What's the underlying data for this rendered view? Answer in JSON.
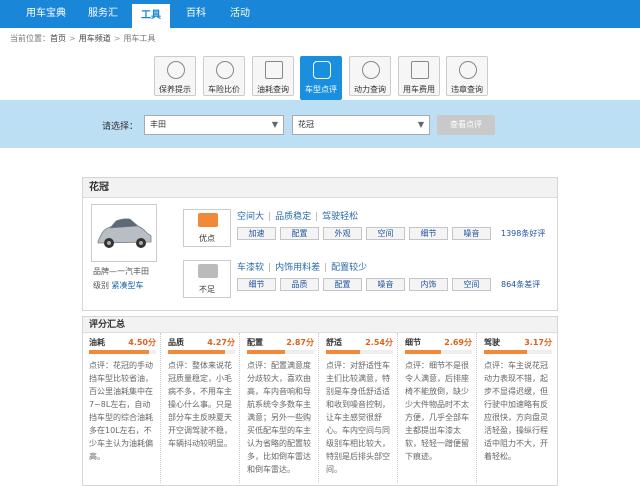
{
  "nav": [
    {
      "label": "用车宝典",
      "active": false
    },
    {
      "label": "服务汇",
      "active": false
    },
    {
      "label": "工具",
      "active": true
    },
    {
      "label": "百科",
      "active": false
    },
    {
      "label": "活动",
      "active": false
    }
  ],
  "breadcrumb": {
    "prefix": "当前位置：",
    "items": [
      "首页",
      "用车频道",
      "用车工具"
    ],
    "sep": ">"
  },
  "tools": [
    {
      "label": "保养提示",
      "icon": "wrench-icon"
    },
    {
      "label": "车险比价",
      "icon": "shield-icon"
    },
    {
      "label": "油耗查询",
      "icon": "fuel-icon"
    },
    {
      "label": "车型点评",
      "icon": "comment-icon",
      "active": true
    },
    {
      "label": "动力查询",
      "icon": "engine-icon"
    },
    {
      "label": "用车费用",
      "icon": "yuan-icon"
    },
    {
      "label": "违章查询",
      "icon": "search-icon"
    }
  ],
  "selection": {
    "label": "请选择：",
    "brand": "丰田",
    "model": "花冠",
    "button": "查看点评"
  },
  "model": {
    "title": "花冠",
    "brand_label": "品牌",
    "brand_value": "一汽丰田",
    "level_label": "级别",
    "level_value": "紧凑型车"
  },
  "pros": {
    "badge": "优点",
    "summary": [
      "空间大",
      "品质稳定",
      "驾驶轻松"
    ],
    "tags": [
      "加速",
      "配置",
      "外观",
      "空间",
      "细节",
      "噪音"
    ],
    "count": "1398条好评"
  },
  "cons": {
    "badge": "不足",
    "summary": [
      "车漆软",
      "内饰用料差",
      "配置较少"
    ],
    "tags": [
      "细节",
      "品质",
      "配置",
      "噪音",
      "内饰",
      "空间"
    ],
    "count": "864条差评"
  },
  "scores": {
    "title": "评分汇总",
    "max": 5,
    "items": [
      {
        "name": "油耗",
        "score": 4.5,
        "display": "4.50分",
        "text": "点评：花冠的手动挡车型比较省油，百公里油耗集中在7~8L左右，自动挡车型的综合油耗多在10L左右，不少车主认为油耗偏高。"
      },
      {
        "name": "品质",
        "score": 4.27,
        "display": "4.27分",
        "text": "点评：整体来说花冠质量稳定，小毛病不多，不用车主操心什么事。只是部分车主反映夏天开空调驾驶不稳，车辆抖动较明显。"
      },
      {
        "name": "配置",
        "score": 2.87,
        "display": "2.87分",
        "text": "点评：配置满意度分歧较大，喜欢由高，车内音响和导航系统令多数车主满意；另外一些购买低配车型的车主认为省略的配置较多，比如倒车雷达和倒车雷达。"
      },
      {
        "name": "舒适",
        "score": 2.54,
        "display": "2.54分",
        "text": "点评：对舒适性车主们比较满意，特别是车身低舒适适和收到噪音控制，让车主感觉很舒心。车内空间与同级别车相比较大，特别是后排头部空间。"
      },
      {
        "name": "细节",
        "score": 2.69,
        "display": "2.69分",
        "text": "点评：细节不是很令人满意，后排座椅不能放倒，缺少少大件物品时不太方便，几乎全部车主都提出车漆太软，轻轻一蹭便留下痕迹。"
      },
      {
        "name": "驾驶",
        "score": 3.17,
        "display": "3.17分",
        "text": "点评：车主说花冠动力表现不错，起步不显得迟缓，但行驶中加速略有反应很快，方向盘灵活轻盈，操纵行程适中阻力不大，开着轻松。"
      }
    ]
  },
  "colors": {
    "nav_bg": "#1a86d8",
    "select_bar_bg": "#bcdff4",
    "score_orange": "#e0601c",
    "pros_thumb": "#f08a3a",
    "cons_thumb": "#bbbbbb"
  }
}
